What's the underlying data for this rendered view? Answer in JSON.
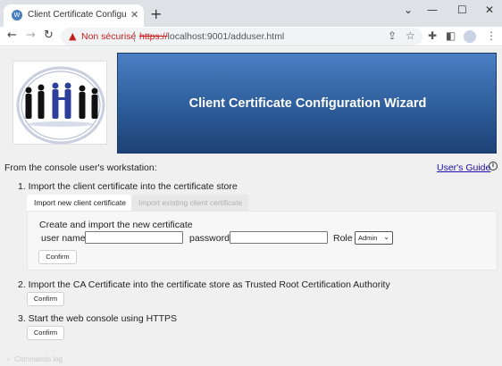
{
  "browser": {
    "tab_title": "Client Certificate Configuration W",
    "tab_favicon": "globe-icon",
    "insecure_label": "Non sécurisé",
    "url_scheme": "https://",
    "url_rest": "localhost:9001/adduser.html"
  },
  "page": {
    "banner_title": "Client Certificate Configuration Wizard",
    "intro": "From the console user's workstation:",
    "guide_link": "User's Guide",
    "step1": {
      "title": "1. Import the client certificate into the certificate store",
      "tabs": [
        "Import new client certificate",
        "Import existing client certificate"
      ],
      "panel_heading": "Create and import the new certificate",
      "username_label": "user name",
      "username_value": "",
      "password_label": "password",
      "password_value": "",
      "role_label": "Role",
      "role_value": "Admin",
      "confirm_label": "Confirm"
    },
    "step2": {
      "title": "2. Import the CA Certificate into the certificate store as Trusted Root Certification Authority",
      "confirm_label": "Confirm"
    },
    "step3": {
      "title": "3. Start the web console using HTTPS",
      "confirm_label": "Confirm"
    },
    "commands_log": "Commands log"
  },
  "colors": {
    "banner_top": "#4a7fc4",
    "banner_bottom": "#1d4276",
    "link": "#1a0dab",
    "insecure": "#c5221f"
  }
}
